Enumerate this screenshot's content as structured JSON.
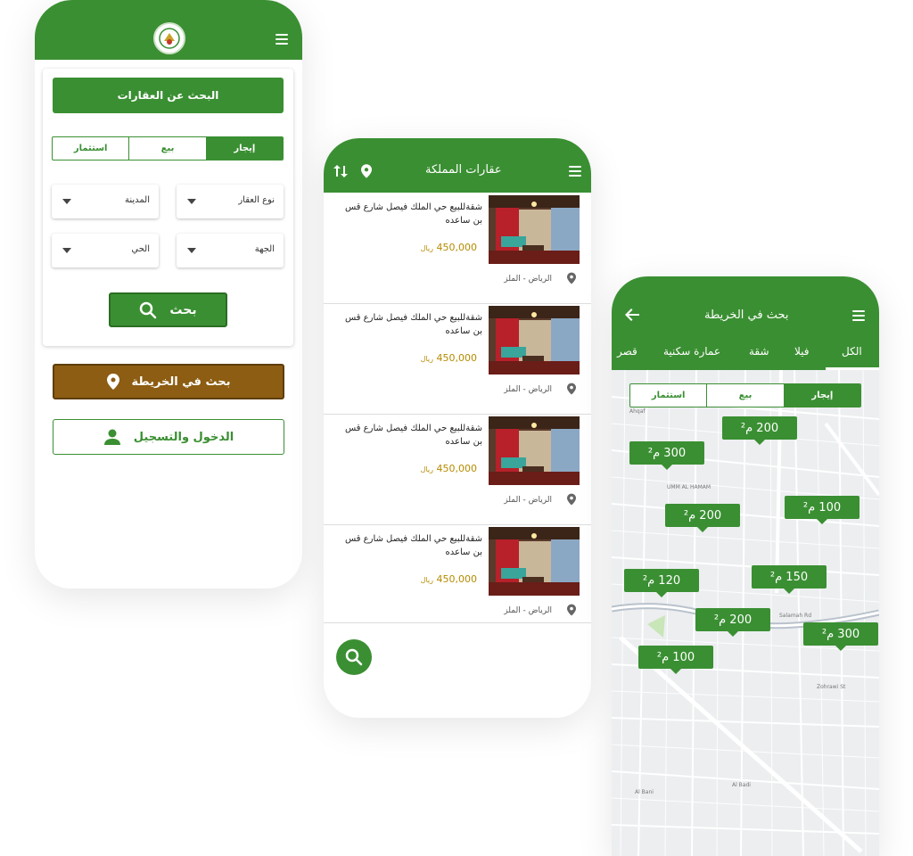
{
  "home": {
    "search_title": "البحث عن العقارات",
    "segments": [
      "إيجار",
      "بيع",
      "استثمار"
    ],
    "filters": {
      "property_type": "نوع العقار",
      "city": "المدينة",
      "region": "الجهة",
      "district": "الحي"
    },
    "search_button": "بحث",
    "map_button": "بحث في الخريطة",
    "login_button": "الدخول والتسجيل",
    "logo_icon": "logo-icon"
  },
  "listings_screen": {
    "title": "عقارات المملكة",
    "items": [
      {
        "title": "شقةللبيع حي الملك فيصل شارع قس بن ساعده",
        "price": "450,000",
        "currency": "ريال",
        "location": "الرياض - الملز"
      },
      {
        "title": "شقةللبيع حي الملك فيصل شارع قس بن ساعده",
        "price": "450,000",
        "currency": "ريال",
        "location": "الرياض - الملز"
      },
      {
        "title": "شقةللبيع حي الملك فيصل شارع قس بن ساعده",
        "price": "450,000",
        "currency": "ريال",
        "location": "الرياض - الملز"
      },
      {
        "title": "شقةللبيع حي الملك فيصل شارع قس بن ساعده",
        "price": "450,000",
        "currency": "ريال",
        "location": "الرياض - الملز"
      }
    ]
  },
  "map_screen": {
    "title": "بحث في الخريطة",
    "tabs": [
      "الكل",
      "فيلا",
      "شقة",
      "عمارة سكنية",
      "قصر"
    ],
    "segments": [
      "إيجار",
      "بيع",
      "استثمار"
    ],
    "markers": [
      {
        "value": "200"
      },
      {
        "value": "300"
      },
      {
        "value": "200"
      },
      {
        "value": "100"
      },
      {
        "value": "150"
      },
      {
        "value": "120"
      },
      {
        "value": "200"
      },
      {
        "value": "300"
      },
      {
        "value": "100"
      }
    ],
    "unit": "م²",
    "map_labels": [
      "UMM AL HAMAM",
      "Zohrawi St",
      "Al Badi",
      "Al Bani",
      "Salamah Rd",
      "Ahqaf"
    ]
  },
  "colors": {
    "primary": "#3a8f32",
    "brown": "#8c5d12",
    "price": "#b58b00"
  }
}
